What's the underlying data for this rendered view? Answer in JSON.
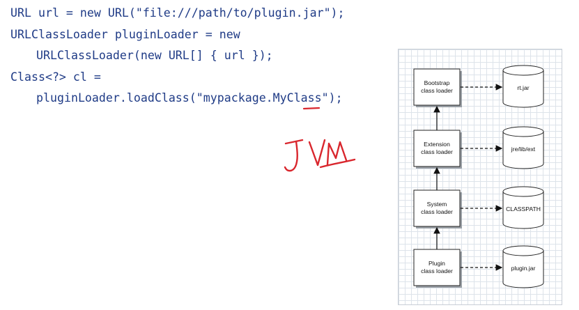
{
  "code_lines": [
    "URL url = new URL(\"file:///path/to/plugin.jar\");",
    "URLClassLoader pluginLoader = new",
    "URLClassLoader(new URL[] { url });",
    "Class<?> cl =",
    "pluginLoader.loadClass(\"mypackage.MyClass\");"
  ],
  "annotation": {
    "handwritten_text": "JVM",
    "ink_color": "#d9262d"
  },
  "diagram": {
    "loaders": [
      {
        "line1": "Bootstrap",
        "line2": "class loader"
      },
      {
        "line1": "Extension",
        "line2": "class loader"
      },
      {
        "line1": "System",
        "line2": "class loader"
      },
      {
        "line1": "Plugin",
        "line2": "class loader"
      }
    ],
    "sources": [
      "rt.jar",
      "jre/lib/ext",
      "CLASSPATH",
      "plugin.jar"
    ]
  },
  "colors": {
    "code_text": "#1f3b86",
    "annotation_ink": "#d9262d"
  }
}
